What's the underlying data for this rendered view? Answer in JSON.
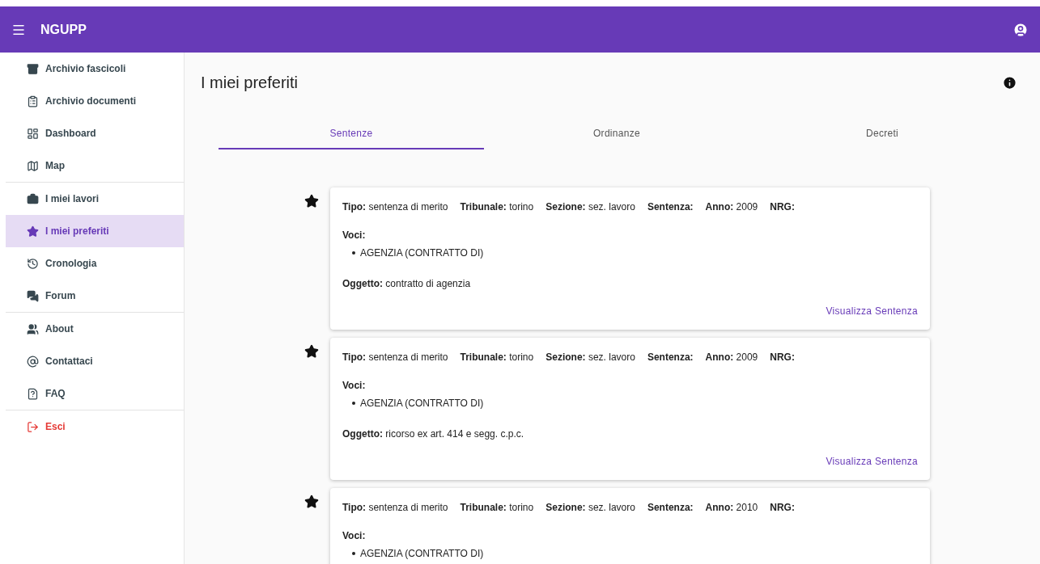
{
  "app_bar": {
    "title": "NGUPP"
  },
  "sidebar": {
    "groups": [
      [
        {
          "label": "Archivio fascicoli",
          "selected": false,
          "kind": "normal"
        },
        {
          "label": "Archivio documenti",
          "selected": false,
          "kind": "normal"
        },
        {
          "label": "Dashboard",
          "selected": false,
          "kind": "normal"
        },
        {
          "label": "Map",
          "selected": false,
          "kind": "normal"
        }
      ],
      [
        {
          "label": "I miei lavori",
          "selected": false,
          "kind": "normal"
        },
        {
          "label": "I miei preferiti",
          "selected": true,
          "kind": "normal"
        },
        {
          "label": "Cronologia",
          "selected": false,
          "kind": "normal"
        },
        {
          "label": "Forum",
          "selected": false,
          "kind": "normal"
        }
      ],
      [
        {
          "label": "About",
          "selected": false,
          "kind": "normal"
        },
        {
          "label": "Contattaci",
          "selected": false,
          "kind": "normal"
        },
        {
          "label": "FAQ",
          "selected": false,
          "kind": "normal"
        }
      ],
      [
        {
          "label": "Esci",
          "selected": false,
          "kind": "danger"
        }
      ]
    ]
  },
  "page": {
    "title": "I miei preferiti"
  },
  "tabs": [
    {
      "label": "Sentenze",
      "selected": true
    },
    {
      "label": "Ordinanze",
      "selected": false
    },
    {
      "label": "Decreti",
      "selected": false
    }
  ],
  "cards": [
    {
      "starred": true,
      "fields": [
        {
          "label": "Tipo:",
          "value": "sentenza di merito"
        },
        {
          "label": "Tribunale:",
          "value": "torino"
        },
        {
          "label": "Sezione:",
          "value": "sez. lavoro"
        },
        {
          "label": "Sentenza:"
        },
        {
          "label": "Anno:",
          "value": "2009"
        },
        {
          "label": "NRG:"
        }
      ],
      "voci_label": "Voci:",
      "voci": [
        "AGENZIA (CONTRATTO DI)"
      ],
      "oggetto_label": "Oggetto:",
      "oggetto": "contratto di agenzia",
      "action": "Visualizza Sentenza"
    },
    {
      "starred": true,
      "fields": [
        {
          "label": "Tipo:",
          "value": "sentenza di merito"
        },
        {
          "label": "Tribunale:",
          "value": "torino"
        },
        {
          "label": "Sezione:",
          "value": "sez. lavoro"
        },
        {
          "label": "Sentenza:"
        },
        {
          "label": "Anno:",
          "value": "2009"
        },
        {
          "label": "NRG:"
        }
      ],
      "voci_label": "Voci:",
      "voci": [
        "AGENZIA (CONTRATTO DI)"
      ],
      "oggetto_label": "Oggetto:",
      "oggetto": "ricorso ex art. 414 e segg. c.p.c.",
      "action": "Visualizza Sentenza"
    },
    {
      "starred": true,
      "fields": [
        {
          "label": "Tipo:",
          "value": "sentenza di merito"
        },
        {
          "label": "Tribunale:",
          "value": "torino"
        },
        {
          "label": "Sezione:",
          "value": "sez. lavoro"
        },
        {
          "label": "Sentenza:"
        },
        {
          "label": "Anno:",
          "value": "2010"
        },
        {
          "label": "NRG:"
        }
      ],
      "voci_label": "Voci:",
      "voci": [
        "AGENZIA (CONTRATTO DI)"
      ]
    }
  ]
}
